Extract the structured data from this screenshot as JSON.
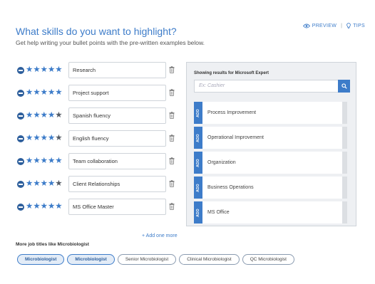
{
  "header": {
    "preview_label": "PREVIEW",
    "separator": "|",
    "tips_label": "TIPS",
    "title": "What skills do you want to highlight?",
    "subtitle": "Get help writing your bullet points with the pre-written examples below."
  },
  "skills": [
    {
      "name": "Research",
      "rating": 5
    },
    {
      "name": "Project support",
      "rating": 5
    },
    {
      "name": "Spanish fluency",
      "rating": 4
    },
    {
      "name": "English fluency",
      "rating": 4
    },
    {
      "name": "Team collaboration",
      "rating": 5
    },
    {
      "name": "Client Relationships",
      "rating": 4
    },
    {
      "name": "MS Office Master",
      "rating": 5
    }
  ],
  "skills_max_rating": 5,
  "add_more_label": "+ Add one more",
  "panel": {
    "heading": "Showing results for Microsoft Expert",
    "search_placeholder": "Ex: Cashier",
    "add_tab_label": "ADD",
    "results": [
      "Process Improvement",
      "Operational Improvement",
      "Organization",
      "Business Operations",
      "MS Office"
    ]
  },
  "related": {
    "label": "More job titles like Microbiologist",
    "chips": [
      {
        "label": "Microbiologist",
        "active": true
      },
      {
        "label": "Microbiologist",
        "active": true
      },
      {
        "label": "Senior Microbiologist",
        "active": false
      },
      {
        "label": "Clinical Microbiologist",
        "active": false
      },
      {
        "label": "QC Microbiologist",
        "active": false
      }
    ]
  },
  "colors": {
    "accent": "#3d7cc9",
    "dark_accent": "#2e5f9c",
    "star_off": "#555c66"
  },
  "icons": {
    "preview": "eye-icon",
    "tips": "lightbulb-icon",
    "remove": "minus-circle-icon",
    "star": "star-icon",
    "delete": "trash-icon",
    "search": "search-icon"
  }
}
